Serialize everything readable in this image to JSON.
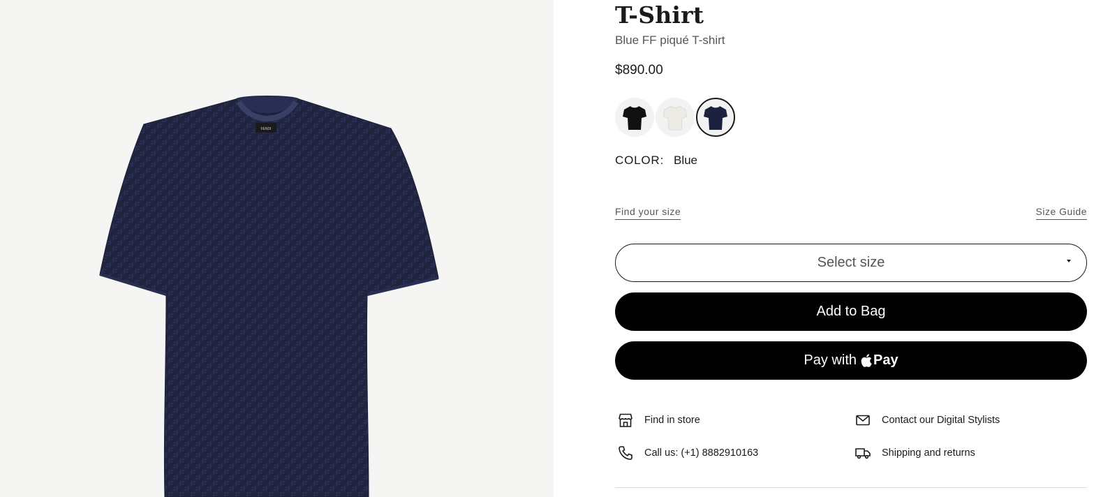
{
  "product": {
    "title": "T-Shirt",
    "subtitle": "Blue FF piqué T-shirt",
    "price": "$890.00",
    "label_text": "FENDI"
  },
  "swatches": [
    {
      "name": "Black",
      "color": "#111111",
      "selected": false
    },
    {
      "name": "White",
      "color": "#ecebe6",
      "selected": false
    },
    {
      "name": "Blue",
      "color": "#1d2140",
      "selected": true
    }
  ],
  "color": {
    "label": "COLOR:",
    "value": "Blue"
  },
  "links": {
    "find_size": "Find your size",
    "size_guide": "Size Guide"
  },
  "size_select": {
    "placeholder": "Select size"
  },
  "buttons": {
    "add_to_bag": "Add to Bag",
    "pay_with": "Pay with",
    "apple_pay": "Pay"
  },
  "services": {
    "find_in_store": {
      "label": "Find in store",
      "icon": "store-icon"
    },
    "call_us": {
      "label": "Call us: (+1) 8882910163",
      "icon": "phone-icon"
    },
    "contact_stylists": {
      "label": "Contact our Digital Stylists",
      "icon": "envelope-icon"
    },
    "shipping_returns": {
      "label": "Shipping and returns",
      "icon": "truck-icon"
    }
  },
  "colors": {
    "background_gallery": "#f5f5f4",
    "shirt_navy": "#1d2140",
    "button_black": "#000000"
  }
}
